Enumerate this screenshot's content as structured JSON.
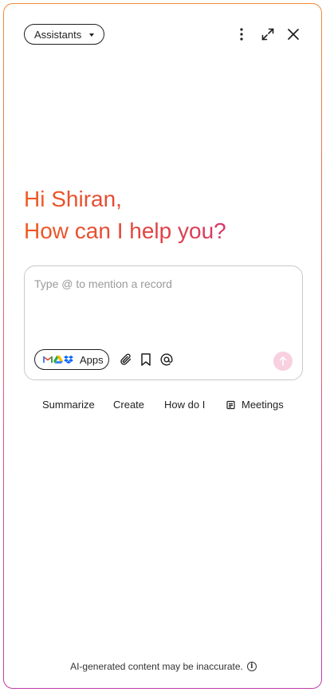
{
  "header": {
    "assistants_label": "Assistants",
    "icons": [
      "more-vertical-icon",
      "expand-icon",
      "close-icon"
    ]
  },
  "greeting": {
    "line1": "Hi Shiran,",
    "line2": "How can I help you?",
    "gradient": [
      "#ef5a1f",
      "#cf2a8a"
    ]
  },
  "composer": {
    "placeholder": "Type @ to mention a record",
    "value": "",
    "apps_label": "Apps",
    "app_logos": [
      "gmail-icon",
      "google-drive-icon",
      "dropbox-icon"
    ],
    "tools": [
      "paperclip-icon",
      "bookmark-icon",
      "at-sign-icon"
    ],
    "send_color": "#f8d0e0"
  },
  "suggestions": {
    "items": [
      "Summarize",
      "Create",
      "How do I",
      "Meetings"
    ]
  },
  "footer": {
    "disclaimer": "AI-generated content may be inaccurate.",
    "info_glyph": "i"
  }
}
